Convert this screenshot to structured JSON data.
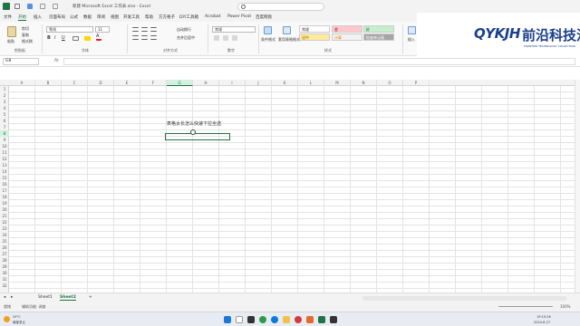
{
  "window": {
    "title": "新建 Microsoft Excel 工作表.xlsx  -  Excel",
    "search_placeholder": ""
  },
  "menu": {
    "tabs": [
      "文件",
      "开始",
      "插入",
      "页面布局",
      "公式",
      "数据",
      "审阅",
      "视图",
      "开发工具",
      "帮助",
      "方方格子",
      "DIY工具箱",
      "Acrobat",
      "Power Pivot",
      "百度网盘"
    ],
    "active_tab": "开始"
  },
  "ribbon": {
    "clipboard": {
      "paste": "粘贴",
      "cut": "剪切",
      "copy": "复制",
      "format_painter": "格式刷",
      "label": "剪贴板"
    },
    "font": {
      "name": "等线",
      "size": "11",
      "label": "字体"
    },
    "alignment": {
      "wrap": "自动换行",
      "merge": "合并后居中",
      "label": "对齐方式"
    },
    "number": {
      "format": "常规",
      "label": "数字"
    },
    "styles": {
      "conditional": "条件格式",
      "table": "套用表格格式",
      "cells": [
        "常规",
        "差",
        "好",
        "适中",
        "计算",
        "检查单元格"
      ],
      "label": "样式"
    },
    "insert": "插入"
  },
  "logo": {
    "mark": "QYKJH",
    "name": "前沿科技汇",
    "tagline": "FRONTIER TECHNOLOGY COLLECTION"
  },
  "formula_bar": {
    "name_box": "G8",
    "fx": "fx",
    "value": ""
  },
  "sheet": {
    "columns": [
      "A",
      "B",
      "C",
      "D",
      "E",
      "F",
      "G",
      "H",
      "I",
      "J",
      "K",
      "L",
      "M",
      "N",
      "O",
      "P"
    ],
    "selected_column": "G",
    "selected_row": "8",
    "cell_text": "表格太长怎么快速下拉全选"
  },
  "sheet_tabs": {
    "tabs": [
      "Sheet1",
      "Sheet2"
    ],
    "active": "Sheet2",
    "add": "+"
  },
  "status": {
    "ready": "就绪",
    "accessibility": "辅助功能: 调查",
    "zoom": "100%"
  },
  "taskbar": {
    "weather_temp": "29°C",
    "weather_text": "局部多云",
    "time": "19:15:26",
    "date": "2024-6-27"
  },
  "colors": {
    "excel_green": "#217346",
    "logo_blue": "#1a3f8c"
  }
}
